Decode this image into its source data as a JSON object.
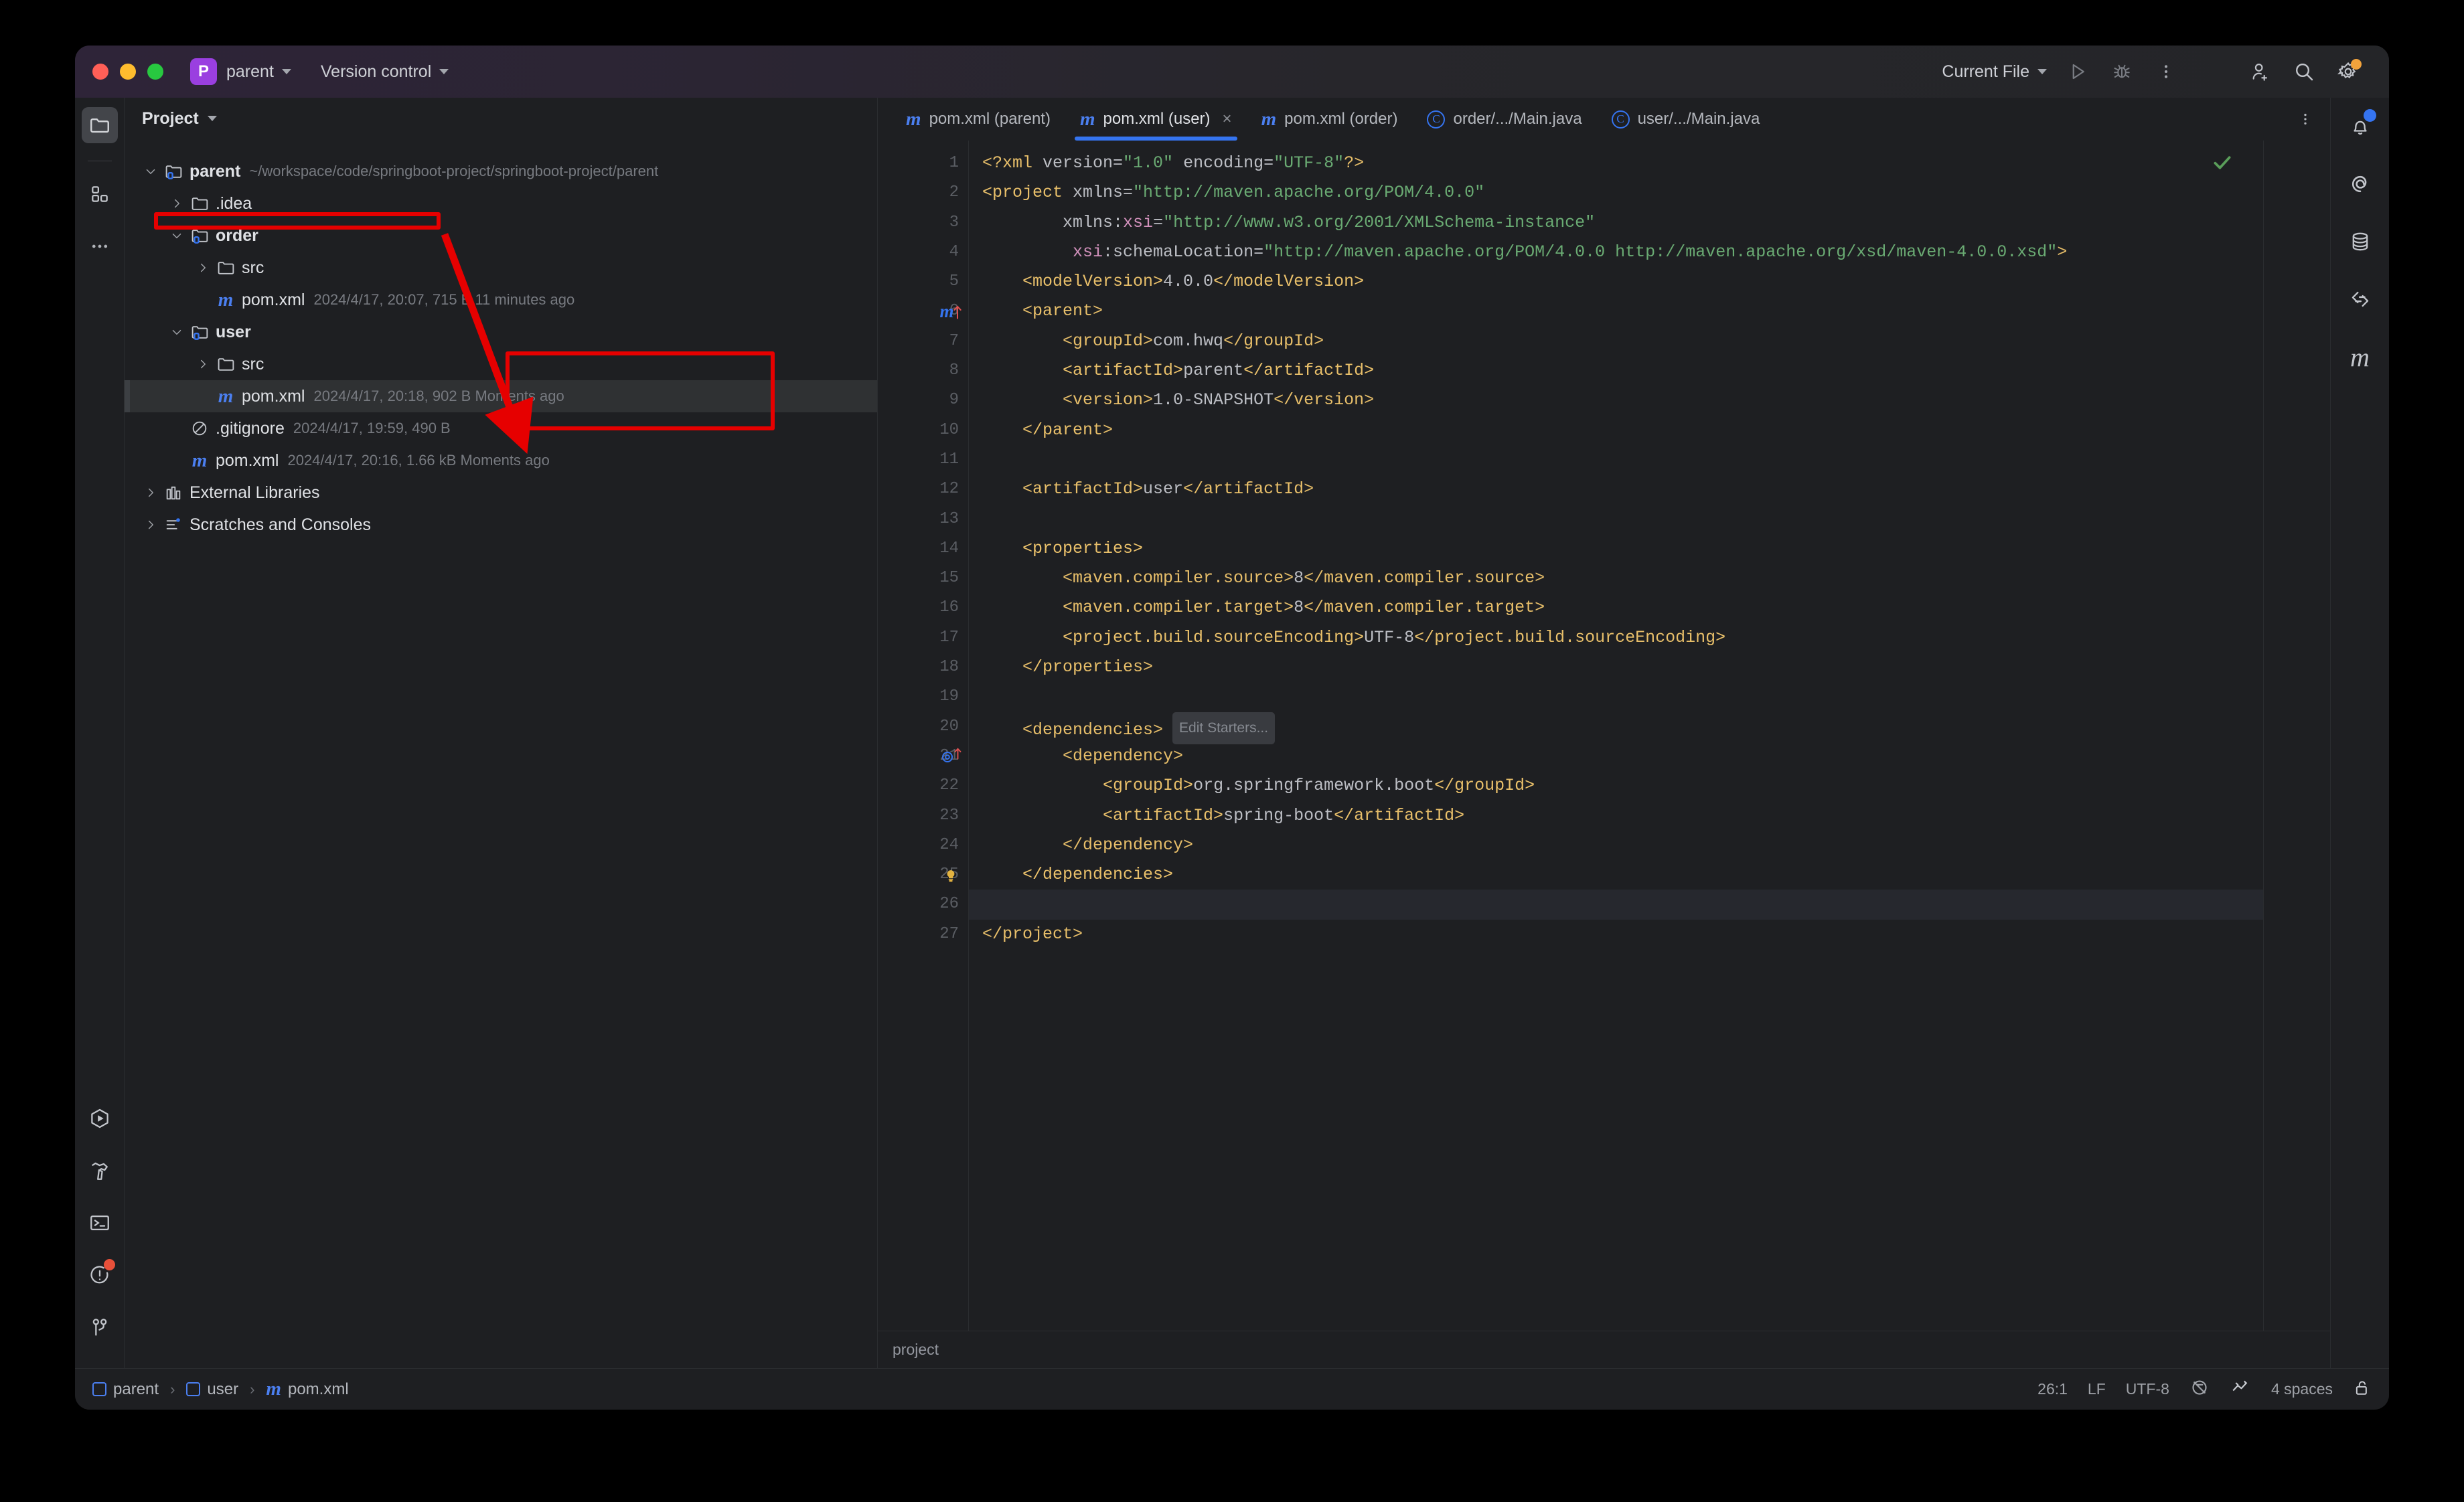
{
  "titlebar": {
    "project_badge": "P",
    "project_name": "parent",
    "vcs_label": "Version control",
    "run_config": "Current File",
    "icons": {
      "run": "run-icon",
      "debug": "debug-icon",
      "more": "more-options-icon",
      "add_user": "add-user-icon",
      "search": "search-icon",
      "settings": "settings-gear-icon"
    }
  },
  "left_strip": {
    "top": [
      {
        "name": "project-tool-window",
        "icon": "folder-icon",
        "active": true
      },
      {
        "name": "commit-tool-window",
        "icon": "commit-squares-icon",
        "active": false
      },
      {
        "name": "more-tool-windows",
        "icon": "ellipsis-icon",
        "active": false
      }
    ],
    "bottom": [
      {
        "name": "run-tool-window",
        "icon": "run-hexagon-icon",
        "badge": ""
      },
      {
        "name": "build-tool-window",
        "icon": "hammer-icon",
        "badge": ""
      },
      {
        "name": "terminal-tool-window",
        "icon": "terminal-icon",
        "badge": ""
      },
      {
        "name": "problems-tool-window",
        "icon": "problems-icon",
        "badge": "red"
      },
      {
        "name": "git-tool-window",
        "icon": "git-branch-icon",
        "badge": ""
      }
    ]
  },
  "project_panel": {
    "title": "Project",
    "tree": [
      {
        "depth": 0,
        "arrow": "down",
        "icon": "module-folder-icon",
        "label": "parent",
        "bold": true,
        "meta": "~/workspace/code/springboot-project/springboot-project/parent",
        "selected": false
      },
      {
        "depth": 1,
        "arrow": "right",
        "icon": "folder-icon",
        "label": ".idea",
        "bold": false,
        "meta": "",
        "selected": false
      },
      {
        "depth": 1,
        "arrow": "down",
        "icon": "module-folder-icon",
        "label": "order",
        "bold": true,
        "meta": "",
        "selected": false
      },
      {
        "depth": 2,
        "arrow": "right",
        "icon": "folder-icon",
        "label": "src",
        "bold": false,
        "meta": "",
        "selected": false
      },
      {
        "depth": 2,
        "arrow": "none",
        "icon": "maven-icon",
        "label": "pom.xml",
        "bold": false,
        "meta": "2024/4/17, 20:07, 715 B 11 minutes ago",
        "selected": false
      },
      {
        "depth": 1,
        "arrow": "down",
        "icon": "module-folder-icon",
        "label": "user",
        "bold": true,
        "meta": "",
        "selected": false
      },
      {
        "depth": 2,
        "arrow": "right",
        "icon": "folder-icon",
        "label": "src",
        "bold": false,
        "meta": "",
        "selected": false
      },
      {
        "depth": 2,
        "arrow": "none",
        "icon": "maven-icon",
        "label": "pom.xml",
        "bold": false,
        "meta": "2024/4/17, 20:18, 902 B Moments ago",
        "selected": true
      },
      {
        "depth": 1,
        "arrow": "none",
        "icon": "gitignore-icon",
        "label": ".gitignore",
        "bold": false,
        "meta": "2024/4/17, 19:59, 490 B",
        "selected": false
      },
      {
        "depth": 1,
        "arrow": "none",
        "icon": "maven-icon",
        "label": "pom.xml",
        "bold": false,
        "meta": "2024/4/17, 20:16, 1.66 kB Moments ago",
        "selected": false
      },
      {
        "depth": 0,
        "arrow": "right",
        "icon": "libraries-icon",
        "label": "External Libraries",
        "bold": false,
        "meta": "",
        "selected": false
      },
      {
        "depth": 0,
        "arrow": "right",
        "icon": "scratches-icon",
        "label": "Scratches and Consoles",
        "bold": false,
        "meta": "",
        "selected": false
      }
    ]
  },
  "editor": {
    "tabs": [
      {
        "label": "pom.xml (parent)",
        "icon": "maven-icon",
        "active": false,
        "closable": false
      },
      {
        "label": "pom.xml (user)",
        "icon": "maven-icon",
        "active": true,
        "closable": true
      },
      {
        "label": "pom.xml (order)",
        "icon": "maven-icon",
        "active": false,
        "closable": false
      },
      {
        "label": "order/.../Main.java",
        "icon": "java-class-icon",
        "active": false,
        "closable": false
      },
      {
        "label": "user/.../Main.java",
        "icon": "java-class-icon",
        "active": false,
        "closable": false
      }
    ],
    "tabs_more_icon": "more-options-icon",
    "inspection_status_icon": "checkmark-ok-icon",
    "footer_breadcrumb": "project",
    "gutter_markers": [
      {
        "line": 6,
        "icon": "maven-parent-link-icon"
      },
      {
        "line": 21,
        "icon": "maven-dependency-link-icon"
      },
      {
        "line": 25,
        "icon": "lightbulb-icon"
      }
    ],
    "current_line": 26,
    "inlay_hints": [
      {
        "line": 20,
        "text": "Edit Starters..."
      }
    ],
    "code_lines": [
      {
        "n": 1,
        "segments": [
          {
            "t": "tag",
            "s": "<?xml "
          },
          {
            "t": "attr",
            "s": "version="
          },
          {
            "t": "val",
            "s": "\"1.0\""
          },
          {
            "t": "attr",
            "s": " encoding="
          },
          {
            "t": "val",
            "s": "\"UTF-8\""
          },
          {
            "t": "tag",
            "s": "?>"
          }
        ]
      },
      {
        "n": 2,
        "segments": [
          {
            "t": "tag",
            "s": "<project "
          },
          {
            "t": "attr",
            "s": "xmlns="
          },
          {
            "t": "val",
            "s": "\"http://maven.apache.org/POM/4.0.0\""
          }
        ]
      },
      {
        "n": 3,
        "segments": [
          {
            "t": "attr",
            "s": "        xmlns:"
          },
          {
            "t": "nsx",
            "s": "xsi"
          },
          {
            "t": "attr",
            "s": "="
          },
          {
            "t": "val",
            "s": "\"http://www.w3.org/2001/XMLSchema-instance\""
          }
        ]
      },
      {
        "n": 4,
        "segments": [
          {
            "t": "attr",
            "s": "         "
          },
          {
            "t": "nsx",
            "s": "xsi"
          },
          {
            "t": "attr",
            "s": ":schemaLocation="
          },
          {
            "t": "val",
            "s": "\"http://maven.apache.org/POM/4.0.0 http://maven.apache.org/xsd/maven-4.0.0.xsd\""
          },
          {
            "t": "tag",
            "s": ">"
          }
        ]
      },
      {
        "n": 5,
        "segments": [
          {
            "t": "tag",
            "s": "    <modelVersion>"
          },
          {
            "t": "txt",
            "s": "4.0.0"
          },
          {
            "t": "tag",
            "s": "</modelVersion>"
          }
        ]
      },
      {
        "n": 6,
        "segments": [
          {
            "t": "tag",
            "s": "    <parent>"
          }
        ]
      },
      {
        "n": 7,
        "segments": [
          {
            "t": "tag",
            "s": "        <groupId>"
          },
          {
            "t": "txt",
            "s": "com.hwq"
          },
          {
            "t": "tag",
            "s": "</groupId>"
          }
        ]
      },
      {
        "n": 8,
        "segments": [
          {
            "t": "tag",
            "s": "        <artifactId>"
          },
          {
            "t": "txt",
            "s": "parent"
          },
          {
            "t": "tag",
            "s": "</artifactId>"
          }
        ]
      },
      {
        "n": 9,
        "segments": [
          {
            "t": "tag",
            "s": "        <version>"
          },
          {
            "t": "txt",
            "s": "1.0-SNAPSHOT"
          },
          {
            "t": "tag",
            "s": "</version>"
          }
        ]
      },
      {
        "n": 10,
        "segments": [
          {
            "t": "tag",
            "s": "    </parent>"
          }
        ]
      },
      {
        "n": 11,
        "segments": []
      },
      {
        "n": 12,
        "segments": [
          {
            "t": "tag",
            "s": "    <artifactId>"
          },
          {
            "t": "txt",
            "s": "user"
          },
          {
            "t": "tag",
            "s": "</artifactId>"
          }
        ]
      },
      {
        "n": 13,
        "segments": []
      },
      {
        "n": 14,
        "segments": [
          {
            "t": "tag",
            "s": "    <properties>"
          }
        ]
      },
      {
        "n": 15,
        "segments": [
          {
            "t": "tag",
            "s": "        <maven.compiler.source>"
          },
          {
            "t": "txt",
            "s": "8"
          },
          {
            "t": "tag",
            "s": "</maven.compiler.source>"
          }
        ]
      },
      {
        "n": 16,
        "segments": [
          {
            "t": "tag",
            "s": "        <maven.compiler.target>"
          },
          {
            "t": "txt",
            "s": "8"
          },
          {
            "t": "tag",
            "s": "</maven.compiler.target>"
          }
        ]
      },
      {
        "n": 17,
        "segments": [
          {
            "t": "tag",
            "s": "        <project.build.sourceEncoding>"
          },
          {
            "t": "txt",
            "s": "UTF-8"
          },
          {
            "t": "tag",
            "s": "</project.build.sourceEncoding>"
          }
        ]
      },
      {
        "n": 18,
        "segments": [
          {
            "t": "tag",
            "s": "    </properties>"
          }
        ]
      },
      {
        "n": 19,
        "segments": []
      },
      {
        "n": 20,
        "segments": [
          {
            "t": "tag",
            "s": "    <dependencies>"
          }
        ],
        "inlay": "Edit Starters..."
      },
      {
        "n": 21,
        "segments": [
          {
            "t": "tag",
            "s": "        <dependency>"
          }
        ]
      },
      {
        "n": 22,
        "segments": [
          {
            "t": "tag",
            "s": "            <groupId>"
          },
          {
            "t": "txt",
            "s": "org.springframework.boot"
          },
          {
            "t": "tag",
            "s": "</groupId>"
          }
        ]
      },
      {
        "n": 23,
        "segments": [
          {
            "t": "tag",
            "s": "            <artifactId>"
          },
          {
            "t": "txt",
            "s": "spring-boot"
          },
          {
            "t": "tag",
            "s": "</artifactId>"
          }
        ]
      },
      {
        "n": 24,
        "segments": [
          {
            "t": "tag",
            "s": "        </dependency>"
          }
        ]
      },
      {
        "n": 25,
        "segments": [
          {
            "t": "tag",
            "s": "    </dependencies>"
          }
        ]
      },
      {
        "n": 26,
        "segments": []
      },
      {
        "n": 27,
        "segments": [
          {
            "t": "tag",
            "s": "</project>"
          }
        ]
      }
    ]
  },
  "right_strip": [
    {
      "name": "notifications-tool-window",
      "icon": "bell-icon",
      "badge": "blue"
    },
    {
      "name": "ai-assistant-tool-window",
      "icon": "spiral-icon",
      "badge": ""
    },
    {
      "name": "database-tool-window",
      "icon": "database-icon",
      "badge": ""
    },
    {
      "name": "endpoints-tool-window",
      "icon": "endpoints-icon",
      "badge": ""
    },
    {
      "name": "maven-tool-window",
      "icon": "maven-icon",
      "badge": ""
    }
  ],
  "statusbar": {
    "breadcrumb": [
      {
        "label": "parent",
        "icon": "module-icon"
      },
      {
        "label": "user",
        "icon": "module-icon"
      },
      {
        "label": "pom.xml",
        "icon": "maven-icon"
      }
    ],
    "caret_position": "26:1",
    "line_separator": "LF",
    "encoding": "UTF-8",
    "indent": "4 spaces",
    "icons": {
      "inspections": "inspections-off-icon",
      "reader_mode": "reader-mode-icon",
      "lock": "unlocked-icon"
    }
  },
  "annotations": {
    "highlight_tree_row": "pom.xml (user) in project tree",
    "highlight_code_block": "dependencies block",
    "arrow_color": "#e60000"
  }
}
